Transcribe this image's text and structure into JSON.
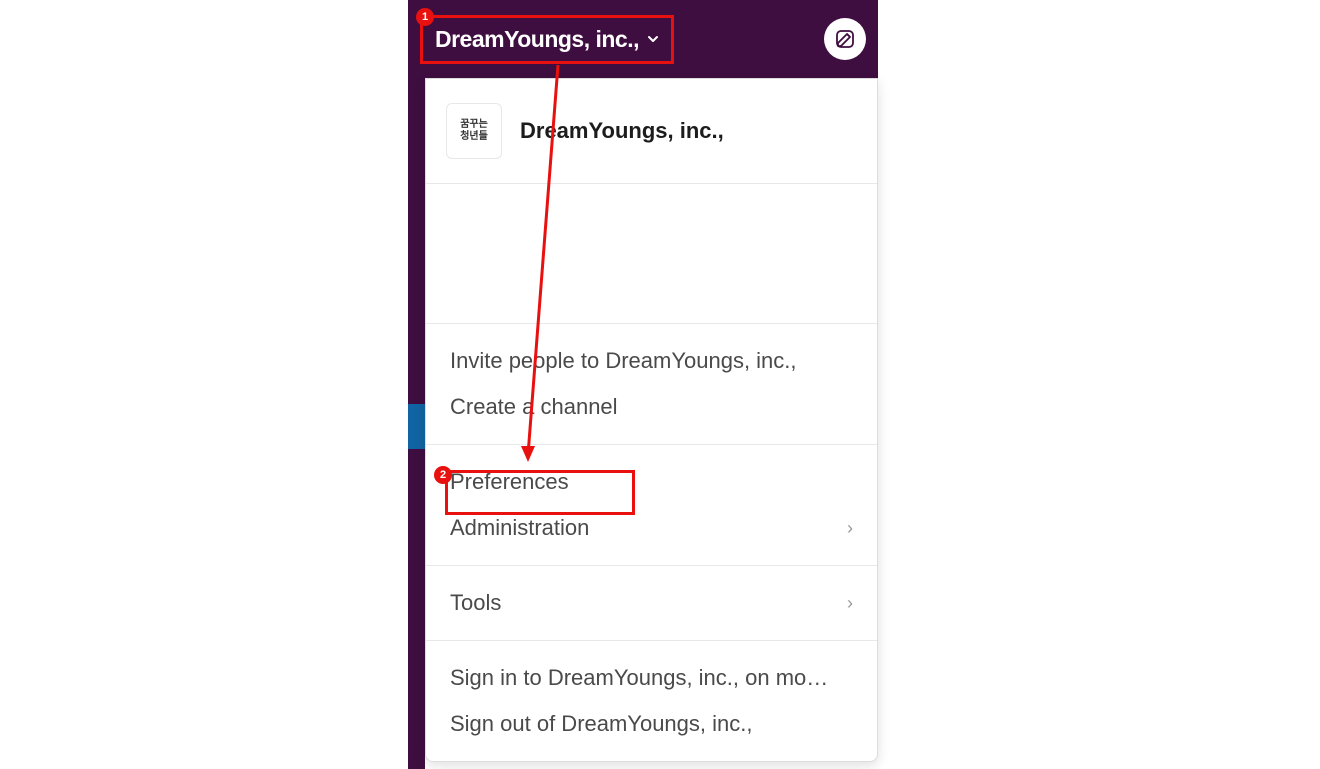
{
  "header": {
    "workspace_title": "DreamYoungs, inc.,",
    "compose_tooltip": "New message"
  },
  "dropdown": {
    "header": {
      "workspace_name": "DreamYoungs, inc.,",
      "icon_text": "꿈꾸는\n청년들"
    },
    "group1": {
      "invite": "Invite people to DreamYoungs, inc.,",
      "create_channel": "Create a channel"
    },
    "group2": {
      "preferences": "Preferences",
      "administration": "Administration"
    },
    "group3": {
      "tools": "Tools"
    },
    "group4": {
      "sign_in": "Sign in to DreamYoungs, inc., on mo…",
      "sign_out": "Sign out of DreamYoungs, inc.,"
    }
  },
  "annotations": {
    "badge1": "1",
    "badge2": "2"
  }
}
